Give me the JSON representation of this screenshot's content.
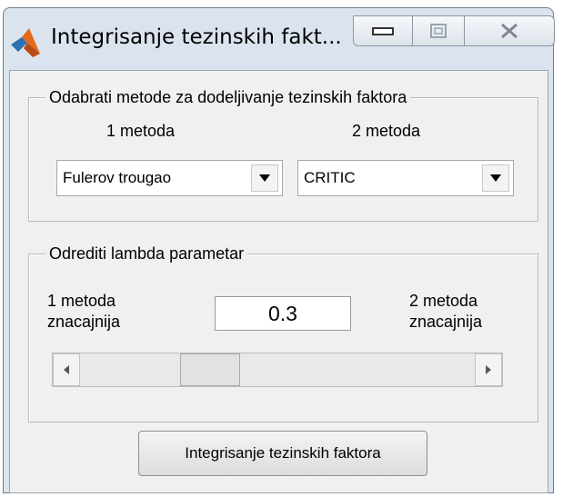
{
  "window": {
    "title": "Integrisanje tezinskih fakt...",
    "buttons": {
      "minimize": "minimize-icon",
      "maximize": "maximize-icon",
      "close": "close-icon"
    }
  },
  "methods_group": {
    "title": "Odabrati metode za dodeljivanje tezinskih faktora",
    "method1_label": "1 metoda",
    "method2_label": "2 metoda",
    "method1_value": "Fulerov trougao",
    "method2_value": "CRITIC"
  },
  "lambda_group": {
    "title": "Odrediti lambda parametar",
    "left_line1": "1 metoda",
    "left_line2": "znacajnija",
    "right_line1": "2 metoda",
    "right_line2": "znacajnija",
    "value": "0.3",
    "slider_fraction": 0.3
  },
  "action": {
    "label": "Integrisanje tezinskih faktora"
  },
  "colors": {
    "window_frame": "#dbe4ee",
    "client_bg": "#f0f0f0"
  }
}
